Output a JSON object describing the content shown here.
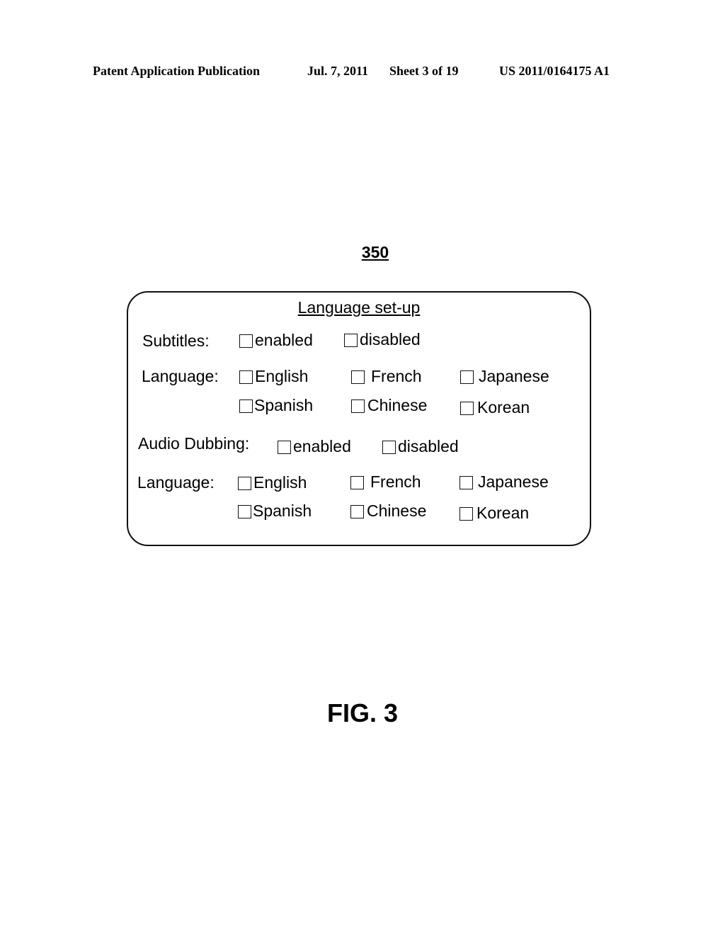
{
  "header": {
    "publication": "Patent Application Publication",
    "date": "Jul. 7, 2011",
    "sheet": "Sheet 3 of 19",
    "number": "US 2011/0164175 A1"
  },
  "reference_numeral": "350",
  "panel": {
    "title": "Language set-up",
    "subtitles": {
      "label": "Subtitles:",
      "options": [
        {
          "label": "enabled",
          "checked": false
        },
        {
          "label": "disabled",
          "checked": false
        }
      ],
      "language_label": "Language:",
      "languages": [
        {
          "label": "English",
          "checked": false
        },
        {
          "label": "French",
          "checked": false
        },
        {
          "label": "Japanese",
          "checked": false
        },
        {
          "label": "Spanish",
          "checked": false
        },
        {
          "label": "Chinese",
          "checked": false
        },
        {
          "label": "Korean",
          "checked": false
        }
      ]
    },
    "audio_dubbing": {
      "label": "Audio Dubbing:",
      "options": [
        {
          "label": "enabled",
          "checked": false
        },
        {
          "label": "disabled",
          "checked": false
        }
      ],
      "language_label": "Language:",
      "languages": [
        {
          "label": "English",
          "checked": false
        },
        {
          "label": "French",
          "checked": false
        },
        {
          "label": "Japanese",
          "checked": false
        },
        {
          "label": "Spanish",
          "checked": false
        },
        {
          "label": "Chinese",
          "checked": false
        },
        {
          "label": "Korean",
          "checked": false
        }
      ]
    }
  },
  "figure_label": "FIG. 3"
}
